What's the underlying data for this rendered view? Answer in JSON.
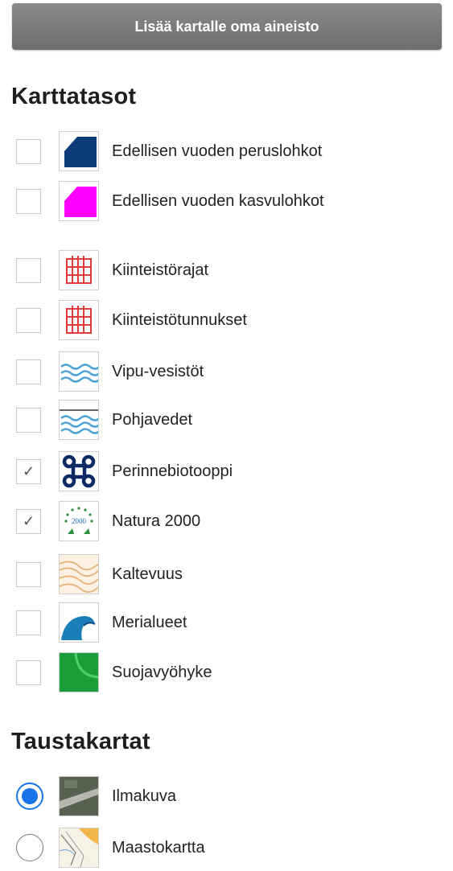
{
  "add_data_button": "Lisää kartalle oma aineisto",
  "map_layers": {
    "title": "Karttatasot",
    "items": [
      {
        "label": "Edellisen vuoden peruslohkot",
        "checked": false,
        "icon": "parcel-dark-blue-icon"
      },
      {
        "label": "Edellisen vuoden kasvulohkot",
        "checked": false,
        "icon": "parcel-magenta-icon"
      },
      {
        "label": "Kiinteistörajat",
        "checked": false,
        "icon": "property-boundary-icon"
      },
      {
        "label": "Kiinteistötunnukset",
        "checked": false,
        "icon": "property-id-icon"
      },
      {
        "label": "Vipu-vesistöt",
        "checked": false,
        "icon": "water-waves-icon"
      },
      {
        "label": "Pohjavedet",
        "checked": false,
        "icon": "groundwater-icon"
      },
      {
        "label": "Perinnebiotooppi",
        "checked": true,
        "icon": "cmd-symbol-icon"
      },
      {
        "label": "Natura 2000",
        "checked": true,
        "icon": "natura-2000-icon"
      },
      {
        "label": "Kaltevuus",
        "checked": false,
        "icon": "contour-lines-icon"
      },
      {
        "label": "Merialueet",
        "checked": false,
        "icon": "sea-wave-icon"
      },
      {
        "label": "Suojavyöhyke",
        "checked": false,
        "icon": "buffer-zone-icon"
      }
    ],
    "check_mark": "✓"
  },
  "background_maps": {
    "title": "Taustakartat",
    "items": [
      {
        "label": "Ilmakuva",
        "selected": true,
        "icon": "aerial-photo-icon"
      },
      {
        "label": "Maastokartta",
        "selected": false,
        "icon": "terrain-map-icon"
      }
    ]
  },
  "colors": {
    "button_bg": "#7a7a7a",
    "radio_accent": "#1a73e8",
    "parcel_blue": "#0d3b7a",
    "parcel_magenta": "#ff00ff",
    "boundary_red": "#e23b3b",
    "water_blue": "#4aa3d8",
    "buffer_green": "#1a9e3a"
  }
}
